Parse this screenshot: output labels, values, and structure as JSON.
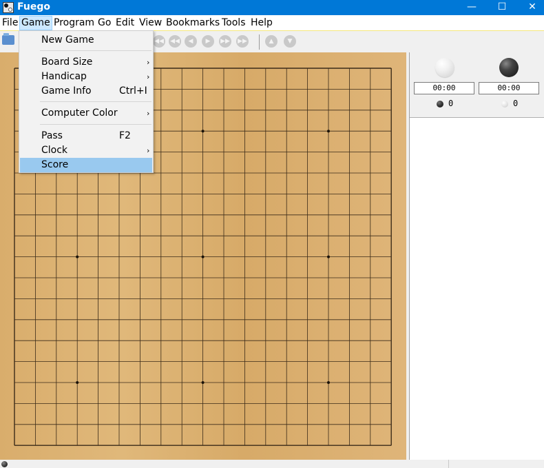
{
  "window": {
    "title": "Fuego",
    "min_glyph": "—",
    "max_glyph": "☐",
    "close_glyph": "✕"
  },
  "menubar": {
    "items": [
      "File",
      "Game",
      "Program",
      "Go",
      "Edit",
      "View",
      "Bookmarks",
      "Tools",
      "Help"
    ],
    "active": "Game"
  },
  "game_menu": {
    "new_game": "New Game",
    "board_size": "Board Size",
    "handicap": "Handicap",
    "game_info": "Game Info",
    "game_info_shortcut": "Ctrl+I",
    "computer_color": "Computer Color",
    "pass": "Pass",
    "pass_shortcut": "F2",
    "clock": "Clock",
    "score": "Score",
    "highlighted": "Score",
    "submenu_arrow": "›"
  },
  "toolbar": {
    "icons": [
      "open-icon",
      "beginning-icon",
      "back-10-icon",
      "back-icon",
      "forward-icon",
      "forward-10-icon",
      "end-icon",
      "previous-variation-icon",
      "next-variation-icon"
    ]
  },
  "board": {
    "size": 19,
    "star_points": [
      [
        3,
        3
      ],
      [
        3,
        9
      ],
      [
        3,
        15
      ],
      [
        9,
        3
      ],
      [
        9,
        9
      ],
      [
        9,
        15
      ],
      [
        15,
        3
      ],
      [
        15,
        9
      ],
      [
        15,
        15
      ]
    ]
  },
  "players": {
    "white": {
      "clock": "00:00",
      "captures": "0"
    },
    "black": {
      "clock": "00:00",
      "captures": "0"
    }
  },
  "colors": {
    "titlebar": "#0078d7",
    "menu_highlight": "#99c9ef",
    "board_wood": "#dcb073"
  }
}
